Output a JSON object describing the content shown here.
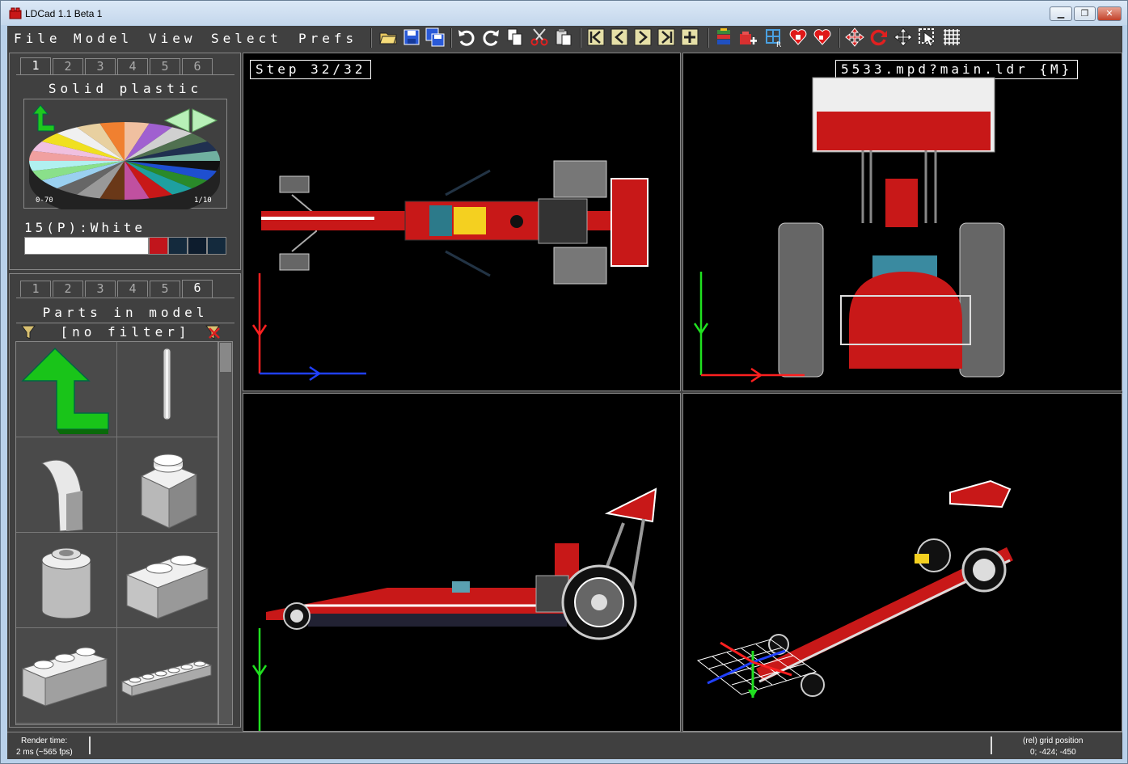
{
  "window": {
    "title": "LDCad 1.1 Beta 1",
    "buttons": [
      "▁",
      "❐",
      "✕"
    ]
  },
  "menu": {
    "items": [
      "File",
      "Model",
      "View",
      "Select",
      "Prefs"
    ]
  },
  "toolbar": {
    "buttons": [
      "open-icon",
      "save-icon",
      "save-all-icon",
      "undo-icon",
      "redo-icon",
      "copy-icon",
      "cut-icon",
      "paste-icon",
      "first-step-icon",
      "prev-step-icon",
      "next-step-icon",
      "last-step-icon",
      "add-step-icon",
      "submodel-icon",
      "add-submodel-icon",
      "grid-icon",
      "favorite-icon",
      "favorite-add-icon",
      "move-icon",
      "rotate-icon",
      "move-mode-icon",
      "select-mode-icon",
      "grid-snap-icon"
    ]
  },
  "color_panel": {
    "tabs": [
      "1",
      "2",
      "3",
      "4",
      "5",
      "6"
    ],
    "active_tab": "1",
    "title": "Solid plastic",
    "range_left": "0-70",
    "range_right": "1/10",
    "selected_color": "15(P):White",
    "swatches": [
      "#ffffff",
      "#c1151c",
      "#142a3d",
      "#0d1c2d",
      "#142a3d"
    ]
  },
  "parts_panel": {
    "tabs": [
      "1",
      "2",
      "3",
      "4",
      "5",
      "6"
    ],
    "active_tab": "6",
    "title": "Parts in model",
    "filter": "[no filter]",
    "parts": [
      "up-arrow",
      "technic-axle",
      "curved-slope",
      "brick-1x1",
      "round-brick",
      "brick-1x2",
      "brick-1x3",
      "plate-1x6"
    ]
  },
  "viewports": {
    "top_left_label": "Step 32/32",
    "top_right_label": "5533.mpd?main.ldr {M}"
  },
  "status": {
    "render_label": "Render time:",
    "render_value": "2 ms (~565 fps)",
    "grid_label": "(rel) grid position",
    "grid_value": "0; -424; -450"
  },
  "colors": {
    "accent_red": "#d42020",
    "axis_red": "#ff2020",
    "axis_green": "#20e020",
    "axis_blue": "#2040ff",
    "panel_bg": "#404040"
  }
}
